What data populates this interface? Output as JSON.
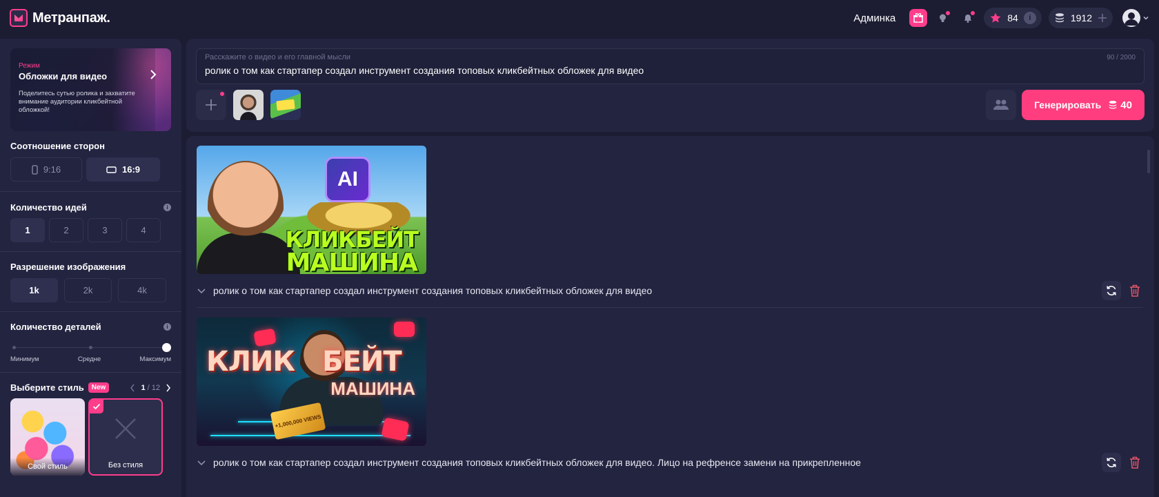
{
  "header": {
    "logo_text": "Метранпаж.",
    "admin_label": "Админка",
    "stars_count": "84",
    "coins_count": "1912",
    "colors": {
      "accent": "#ff3d8b",
      "background": "#1c1d33",
      "panel": "#232440"
    }
  },
  "sidebar": {
    "mode": {
      "label": "Режим",
      "title": "Обложки для видео",
      "description": "Поделитесь сутью ролика и захватите внимание аудитории кликбейтной обложкой!"
    },
    "aspect": {
      "title": "Соотношение сторон",
      "options": [
        {
          "label": "9:16",
          "icon": "portrait-phone-icon",
          "active": false
        },
        {
          "label": "16:9",
          "icon": "landscape-screen-icon",
          "active": true
        }
      ]
    },
    "ideas": {
      "title": "Количество идей",
      "options": [
        "1",
        "2",
        "3",
        "4"
      ],
      "selected": "1"
    },
    "resolution": {
      "title": "Разрешение изображения",
      "options": [
        "1k",
        "2k",
        "4k"
      ],
      "selected": "1k"
    },
    "details": {
      "title": "Количество деталей",
      "labels": [
        "Минимум",
        "Средне",
        "Максимум"
      ],
      "value_fraction": 1.0
    },
    "style": {
      "title": "Выберите стиль",
      "badge": "New",
      "page": "1",
      "total": "/ 12",
      "cards": [
        {
          "label": "Свой стиль",
          "selected": false
        },
        {
          "label": "Без стиля",
          "selected": true
        }
      ]
    }
  },
  "prompt": {
    "placeholder": "Расскажите о видео и его главной мысли",
    "counter": "90 / 2000",
    "value": "ролик о том как стартапер создал инструмент создания топовых кликбейтных обложек для видео",
    "generate_label": "Генерировать",
    "generate_cost": "40"
  },
  "results": [
    {
      "cover_title_line1": "КЛИКБЕЙТ",
      "cover_title_line2": "МАШИНА",
      "cover_chip": "AI",
      "caption": "ролик о том как стартапер создал инструмент создания топовых кликбейтных обложек для видео"
    },
    {
      "cover_title_line1": "КЛИК",
      "cover_title_line2": "БЕЙТ",
      "cover_sub": "МАШИНА",
      "cover_card": "+1,000,000 VIEWS",
      "caption": "ролик о том как стартапер создал инструмент создания топовых кликбейтных обложек для видео. Лицо на рефренсе замени на прикрепленное"
    }
  ]
}
